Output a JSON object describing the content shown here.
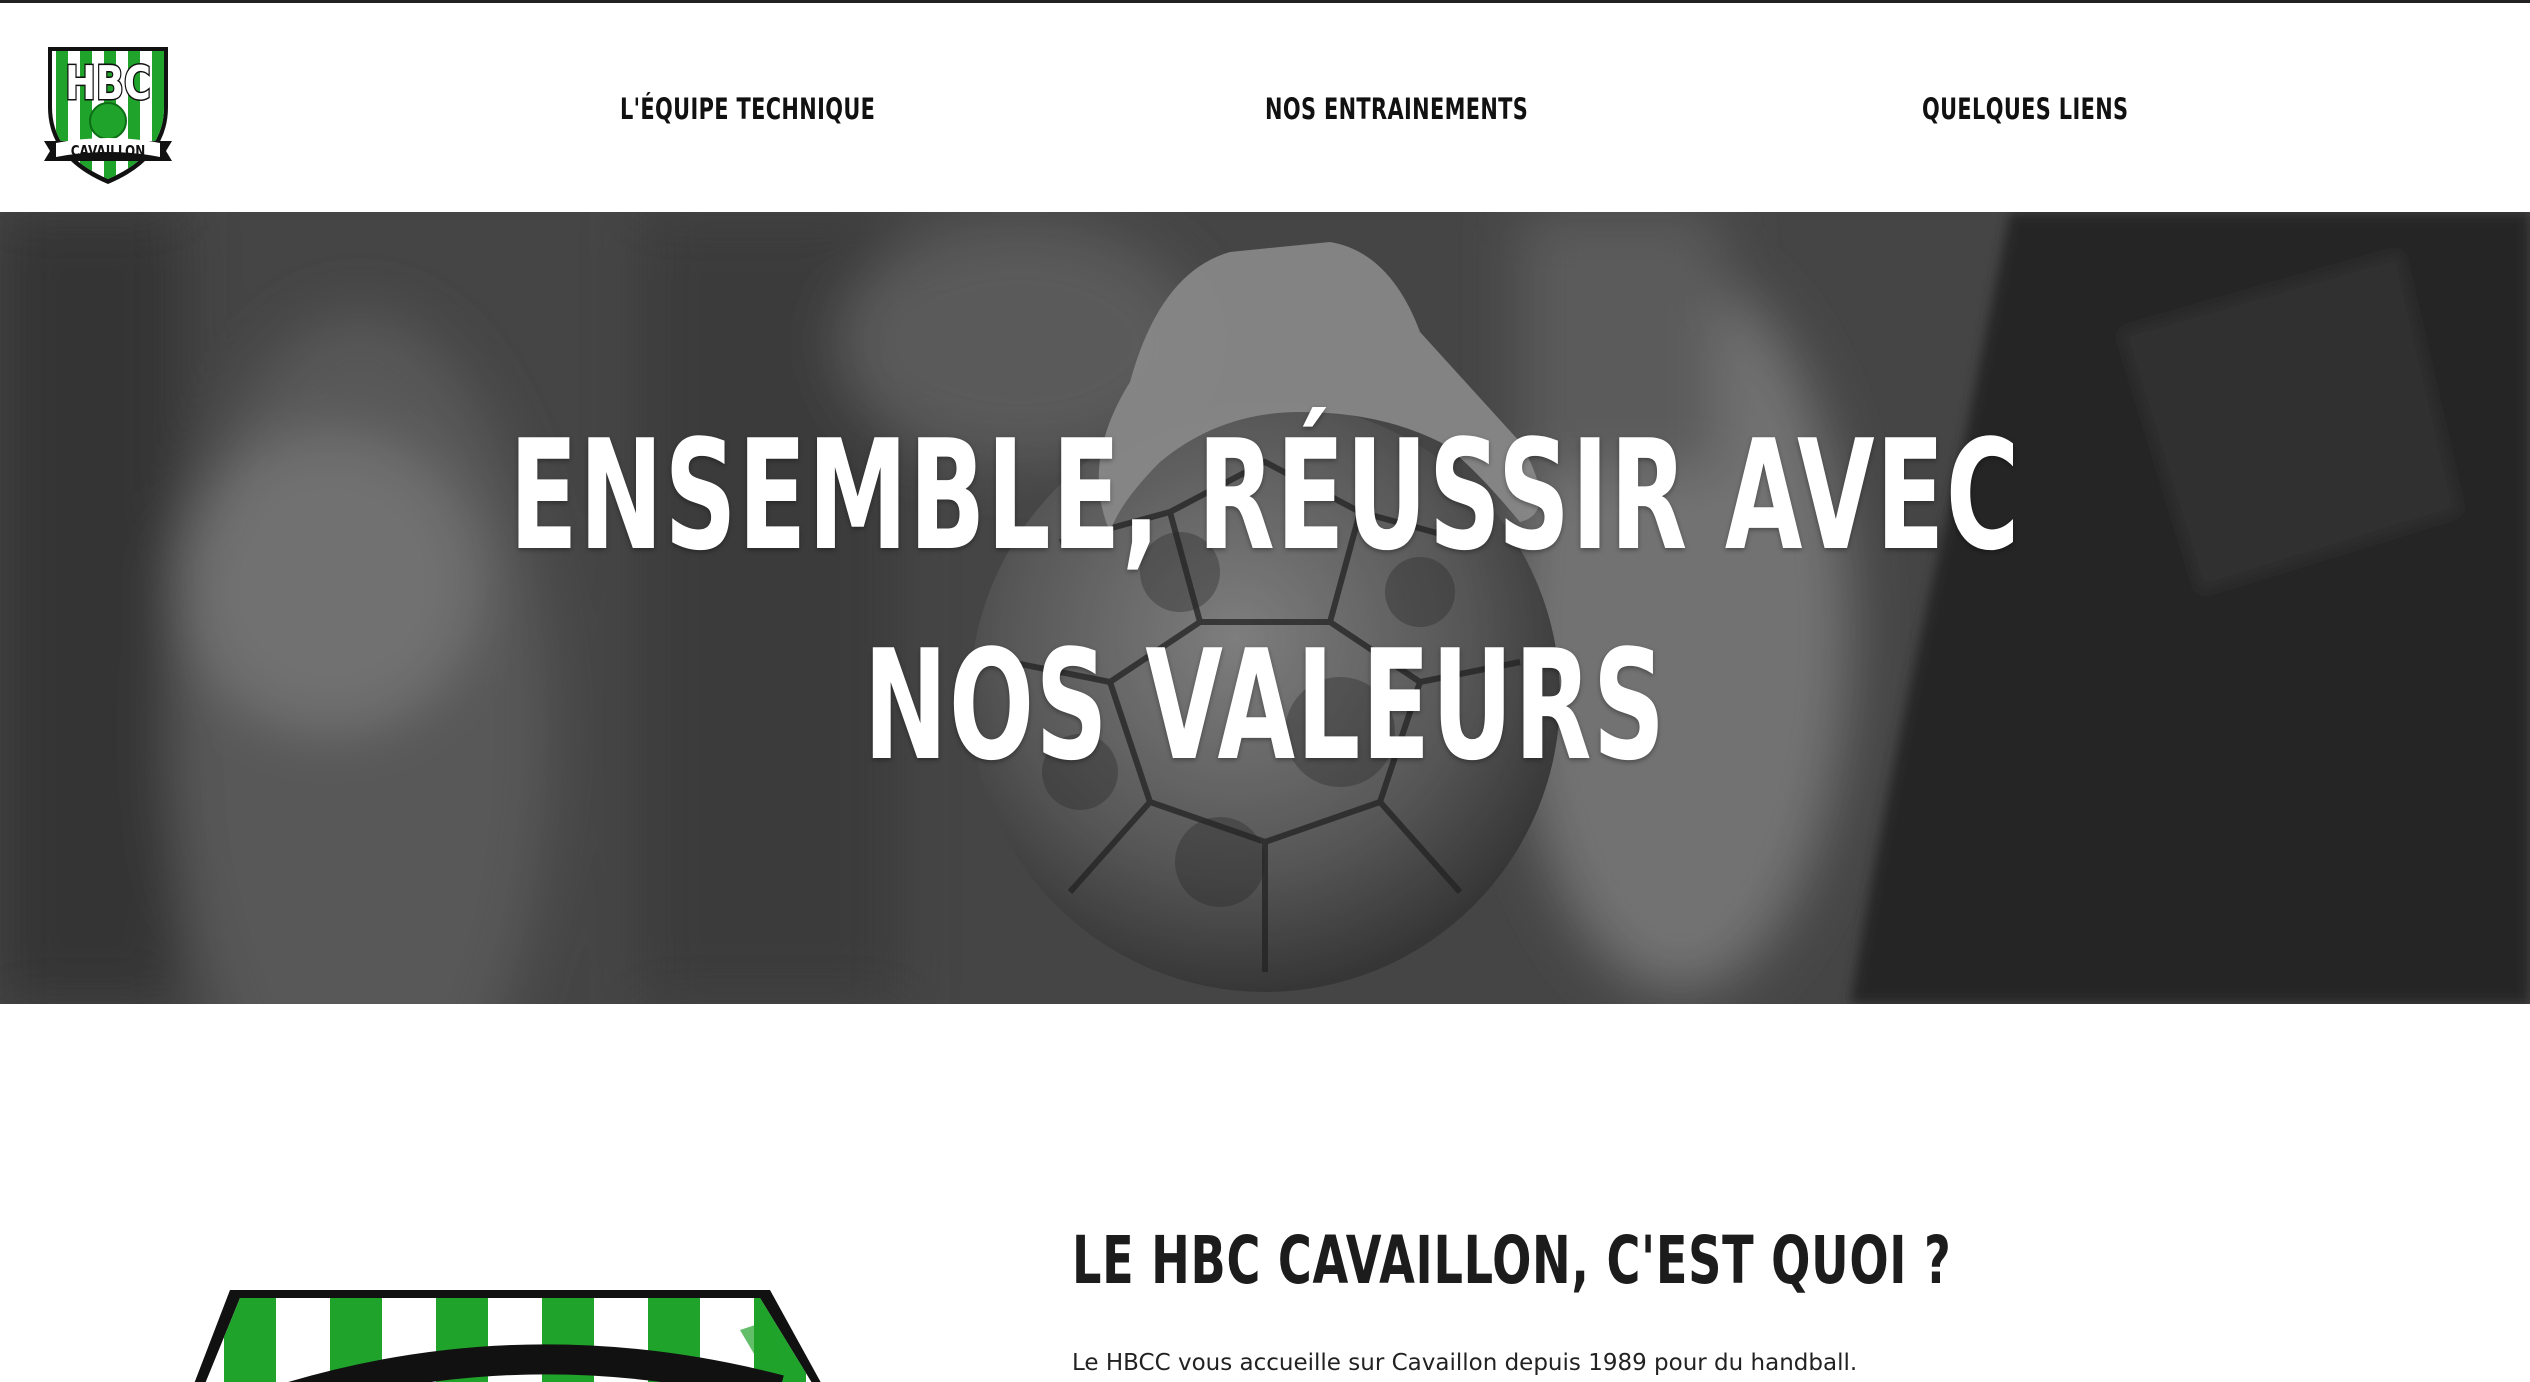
{
  "header": {
    "logo": {
      "icon": "hbc-cavaillon-shield-logo",
      "text_top": "HBC",
      "text_bottom": "CAVAILLON"
    },
    "nav": [
      {
        "label": "L'ÉQUIPE TECHNIQUE"
      },
      {
        "label": "NOS ENTRAINEMENTS"
      },
      {
        "label": "QUELQUES LIENS"
      }
    ]
  },
  "hero": {
    "title_line1": "ENSEMBLE, RÉUSSIR AVEC",
    "title_line2": "NOS VALEURS",
    "background_icon": "handball-in-hand-photo"
  },
  "about": {
    "title": "LE HBC CAVAILLON, C'EST QUOI ?",
    "text": "Le HBCC vous accueille sur Cavaillon depuis 1989 pour du handball."
  },
  "colors": {
    "brand_green": "#1fa32a",
    "text_dark": "#1a1a1a",
    "hero_overlay": "#4a4a4a"
  }
}
